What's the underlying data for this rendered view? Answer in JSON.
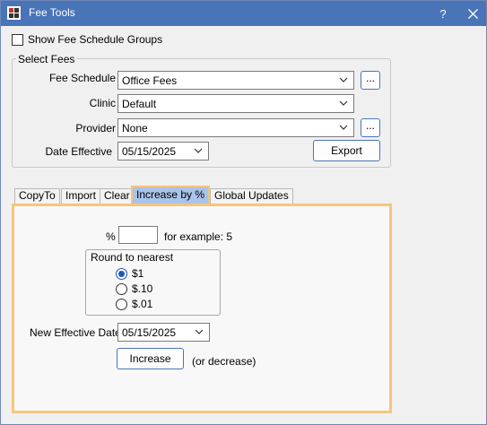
{
  "window": {
    "title": "Fee Tools",
    "help_label": "?",
    "close_label": "✕"
  },
  "options": {
    "show_groups_label": "Show Fee Schedule Groups",
    "show_groups_checked": false
  },
  "select_fees": {
    "title": "Select Fees",
    "fee_schedule": {
      "label": "Fee Schedule",
      "value": "Office Fees",
      "browse": "..."
    },
    "clinic": {
      "label": "Clinic",
      "value": "Default"
    },
    "provider": {
      "label": "Provider",
      "value": "None",
      "browse": "..."
    },
    "date_effective": {
      "label": "Date Effective",
      "value": "05/15/2025"
    },
    "export_label": "Export"
  },
  "tabs": [
    {
      "label": "CopyTo"
    },
    {
      "label": "Import"
    },
    {
      "label": "Clear"
    },
    {
      "label": "Increase by %",
      "active": true
    },
    {
      "label": "Global Updates"
    }
  ],
  "increase_panel": {
    "percent_label": "%",
    "percent_value": "",
    "example": "for example: 5",
    "round": {
      "title": "Round to nearest",
      "options": [
        "$1",
        "$.10",
        "$.01"
      ],
      "selected": "$1"
    },
    "new_date": {
      "label": "New Effective Date",
      "value": "05/15/2025"
    },
    "increase_label": "Increase",
    "decrease_note": "(or decrease)"
  },
  "colors": {
    "titlebar": "#4a74b8",
    "tab_highlight": "#f5c67a",
    "active_tab": "#a9c3ea"
  }
}
